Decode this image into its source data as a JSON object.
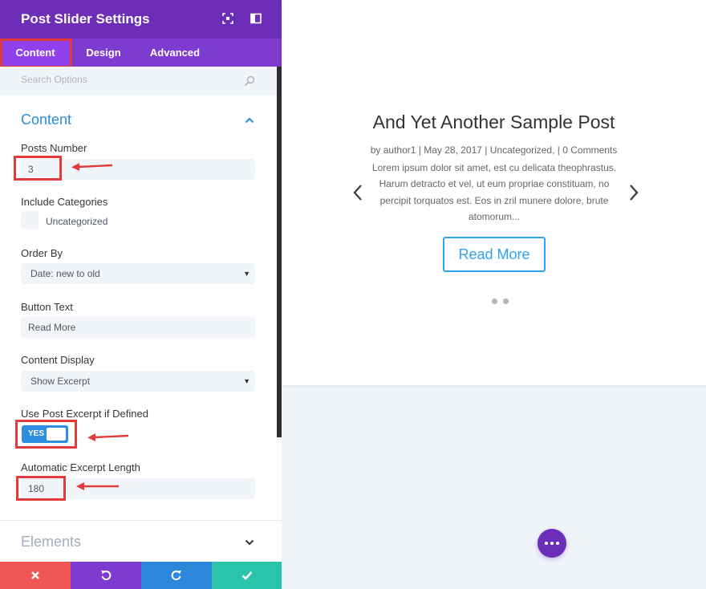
{
  "panel": {
    "title": "Post Slider Settings",
    "tabs": [
      "Content",
      "Design",
      "Advanced"
    ],
    "search_placeholder": "Search Options",
    "section_content": "Content",
    "section_elements": "Elements",
    "fields": {
      "posts_number_label": "Posts Number",
      "posts_number_value": "3",
      "include_categories_label": "Include Categories",
      "category_option": "Uncategorized",
      "order_by_label": "Order By",
      "order_by_value": "Date: new to old",
      "button_text_label": "Button Text",
      "button_text_value": "Read More",
      "content_display_label": "Content Display",
      "content_display_value": "Show Excerpt",
      "use_excerpt_label": "Use Post Excerpt if Defined",
      "use_excerpt_toggle": "YES",
      "excerpt_length_label": "Automatic Excerpt Length",
      "excerpt_length_value": "180"
    },
    "icons": [
      "expand-icon",
      "sidebar-toggle-icon",
      "search-icon",
      "chevron-up-icon",
      "chevron-down-icon",
      "close-icon",
      "undo-icon",
      "redo-icon",
      "check-icon"
    ],
    "colors": {
      "header": "#6c2eb9",
      "tabs": "#7e3bd0",
      "active_tab": "#8f42ec",
      "accent_blue": "#2c8bdb",
      "highlight": "#e23b3b",
      "footer_close": "#ef5555",
      "footer_undo": "#7e3bd0",
      "footer_redo": "#2b87da",
      "footer_save": "#29c4a9"
    }
  },
  "preview": {
    "post_title": "And Yet Another Sample Post",
    "meta": "by author1 | May 28, 2017 | Uncategorized, | 0 Comments",
    "excerpt_lines": [
      "Lorem ipsum dolor sit amet, est cu delicata theophrastus.",
      "Harum detracto et vel, ut eum propriae constituam, no",
      "percipit torquatos est. Eos in zril munere dolore, brute",
      "atomorum..."
    ],
    "read_more": "Read More",
    "slide_count": 2
  }
}
